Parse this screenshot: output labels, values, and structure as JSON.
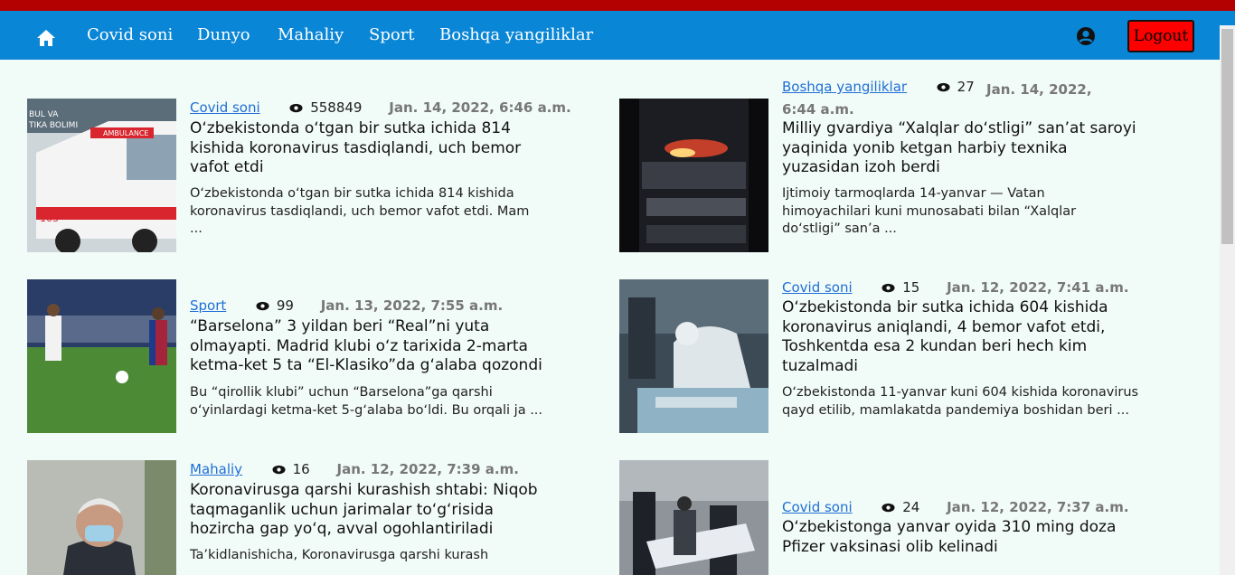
{
  "nav": {
    "links": [
      "Covid soni",
      "Dunyo",
      "Mahaliy",
      "Sport",
      "Boshqa yangiliklar"
    ],
    "logout_label": "Logout"
  },
  "colors": {
    "navbar": "#0a86d6",
    "accent_link": "#1f6fd6",
    "logout": "#ff0000"
  },
  "articles": [
    {
      "category": "Covid soni",
      "views": "558849",
      "date": "Jan. 14, 2022, 6:46 a.m.",
      "title": "O‘zbekistonda o‘tgan bir sutka ichida 814 kishida koronavirus tasdiqlandi, uch bemor vafot etdi",
      "excerpt": "O‘zbekistonda o‘tgan bir sutka ichida 814 kishida koronavirus tasdiqlandi, uch bemor vafot etdi. Mam ...",
      "image_label": "ambulance"
    },
    {
      "category": "Boshqa yangiliklar",
      "views": "27",
      "date": "Jan. 14, 2022, 6:44 a.m.",
      "title": "Milliy gvardiya “Xalqlar do‘stligi” san’at saroyi yaqinida yonib ketgan harbiy texnika yuzasidan izoh berdi",
      "excerpt": "Ijtimoiy tarmoqlarda 14-yanvar — Vatan himoyachilari kuni munosabati bilan “Xalqlar do‘stligi” san’a ...",
      "image_label": "night-fire"
    },
    {
      "category": "Sport",
      "views": "99",
      "date": "Jan. 13, 2022, 7:55 a.m.",
      "title": "“Barselona” 3 yildan beri “Real”ni yuta olmayapti. Madrid klubi o‘z tarixida 2-marta ketma-ket 5 ta “El-Klasiko”da g‘alaba qozondi",
      "excerpt": "Bu “qirollik klubi” uchun “Barselona”ga qarshi o‘yinlardagi ketma-ket 5-g‘alaba bo‘ldi. Bu orqali ja ...",
      "image_label": "football"
    },
    {
      "category": "Covid soni",
      "views": "15",
      "date": "Jan. 12, 2022, 7:41 a.m.",
      "title": "O‘zbekistonda bir sutka ichida 604 kishida koronavirus aniqlandi, 4 bemor vafot etdi, Toshkentda esa 2 kundan beri hech kim tuzalmadi",
      "excerpt": "O‘zbekistonda 11-yanvar kuni 604 kishida koronavirus qayd etilib, mamlakatda pandemiya boshidan beri ...",
      "image_label": "hospital"
    },
    {
      "category": "Mahaliy",
      "views": "16",
      "date": "Jan. 12, 2022, 7:39 a.m.",
      "title": "Koronavirusga qarshi kurashish shtabi: Niqob taqmaganlik uchun jarimalar to‘g‘risida hozircha gap yo‘q, avval ogohlantiriladi",
      "excerpt": "Ta’kidlanishicha, Koronavirusga qarshi kurash",
      "image_label": "official"
    },
    {
      "category": "Covid soni",
      "views": "24",
      "date": "Jan. 12, 2022, 7:37 a.m.",
      "title": "O‘zbekistonga yanvar oyida 310 ming doza Pfizer vaksinasi olib kelinadi",
      "excerpt": "",
      "image_label": "medics"
    }
  ]
}
